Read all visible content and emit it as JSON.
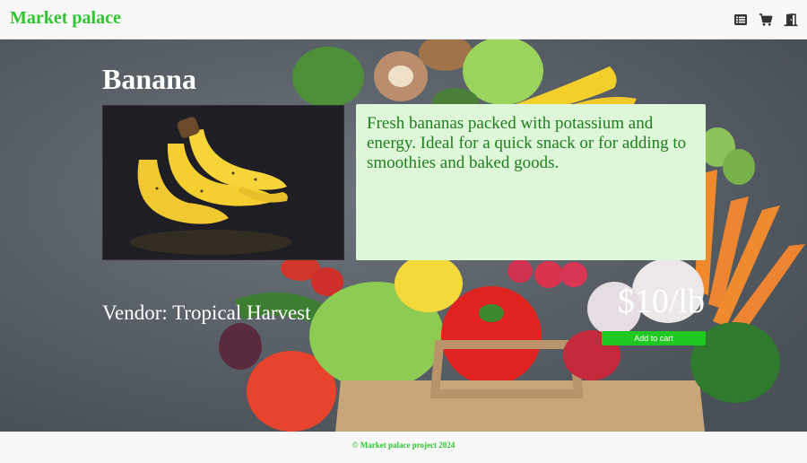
{
  "header": {
    "brand": "Market palace",
    "icons": [
      "list-icon",
      "cart-icon",
      "logout-door-icon"
    ]
  },
  "product": {
    "name": "Banana",
    "description": "Fresh bananas packed with potassium and energy. Ideal for a quick snack or for adding to smoothies and baked goods.",
    "vendor": "Vendor: Tropical Harvest",
    "price": "$10/lb",
    "add_to_cart_label": "Add to cart"
  },
  "footer": {
    "text": "© Market palace project 2024"
  },
  "colors": {
    "brand_green": "#2ec52e",
    "button_green": "#22c822",
    "desc_bg": "#dff7d9",
    "desc_text": "#1f7f1f"
  }
}
